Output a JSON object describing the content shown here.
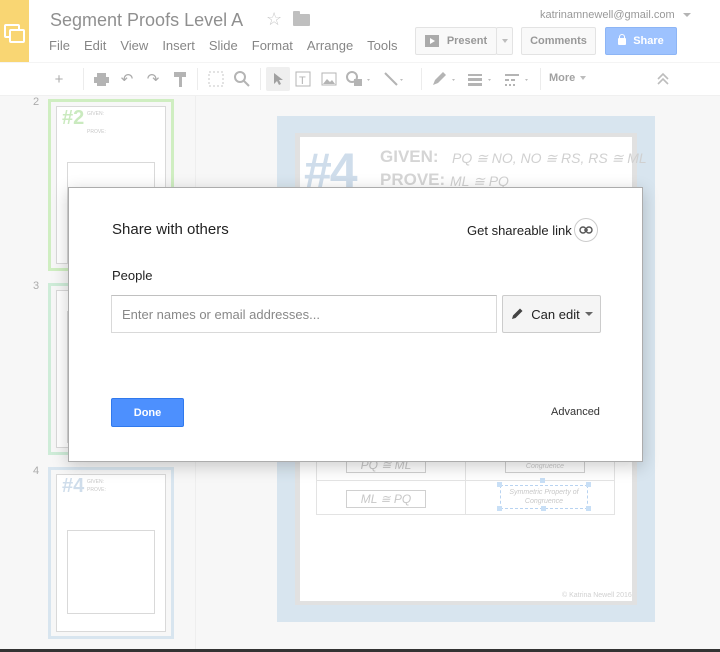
{
  "app": {
    "doc_title": "Segment Proofs Level A",
    "account": "katrinamnewell@gmail.com",
    "menu": [
      "File",
      "Edit",
      "View",
      "Insert",
      "Slide",
      "Format",
      "Arrange",
      "Tools"
    ],
    "present_label": "Present",
    "comments_label": "Comments",
    "share_label": "Share",
    "more_label": "More",
    "colors": {
      "logo": "#f4b400",
      "share": "#4d90fe"
    }
  },
  "filmstrip": {
    "slides": [
      {
        "number": "2",
        "border_color": "#a8e08f",
        "heading": "#2",
        "given": "GIVEN:",
        "prove": "PROVE:"
      },
      {
        "number": "3",
        "border_color": "#a7dcb9"
      },
      {
        "number": "4",
        "border_color": "#b9cfe2",
        "heading": "#4",
        "given": "GIVEN:",
        "prove": "PROVE:"
      }
    ]
  },
  "slide": {
    "heading": "#4",
    "given_label": "GIVEN:",
    "given_statement": "PQ ≅ NO, NO ≅ RS, RS ≅ ML",
    "prove_label": "PROVE:",
    "prove_statement": "ML ≅ PQ",
    "row_left_1": "PQ ≅ ML",
    "row_right_1": "Congruence",
    "row_left_2": "ML ≅ PQ",
    "row_right_2": "Symmetric Property of Congruence",
    "copyright": "© Katrina Newell 2016"
  },
  "dialog": {
    "title": "Share with others",
    "shareable_link_label": "Get shareable link",
    "people_label": "People",
    "people_placeholder": "Enter names or email addresses...",
    "people_value": "",
    "permission_label": "Can edit",
    "done_label": "Done",
    "advanced_label": "Advanced"
  }
}
